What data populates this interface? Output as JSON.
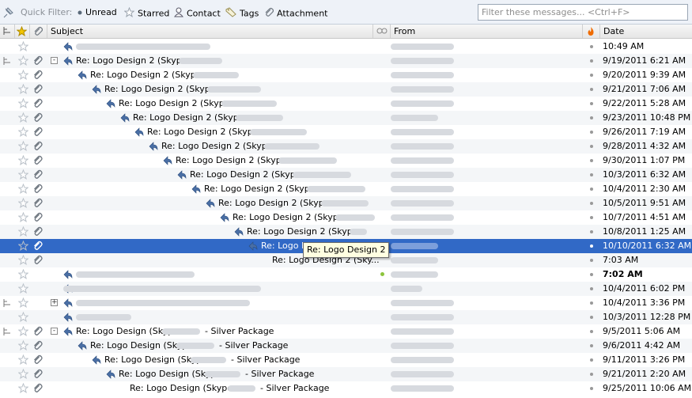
{
  "quick_filter": {
    "label": "Quick Filter:",
    "unread": "Unread",
    "starred": "Starred",
    "contact": "Contact",
    "tags": "Tags",
    "attachment": "Attachment",
    "search_placeholder": "Filter these messages... <Ctrl+F>"
  },
  "columns": {
    "subject": "Subject",
    "from": "From",
    "date": "Date"
  },
  "tooltip": "Re: Logo Design 2",
  "rows": [
    {
      "subject": "",
      "date": "10:49 AM"
    },
    {
      "subject": "Re: Logo Design 2 (Skype:",
      "date": "9/19/2011 6:21 AM"
    },
    {
      "subject": "Re: Logo Design 2 (Skype:",
      "date": "9/20/2011 9:39 AM"
    },
    {
      "subject": "Re: Logo Design 2 (Skype:",
      "date": "9/21/2011 7:06 AM"
    },
    {
      "subject": "Re: Logo Design 2 (Skype:",
      "date": "9/22/2011 5:28 AM"
    },
    {
      "subject": "Re: Logo Design 2 (Skype:",
      "date": "9/23/2011 10:48 PM"
    },
    {
      "subject": "Re: Logo Design 2 (Skype:",
      "date": "9/26/2011 7:19 AM"
    },
    {
      "subject": "Re: Logo Design 2 (Skype:",
      "date": "9/28/2011 4:32 AM"
    },
    {
      "subject": "Re: Logo Design 2 (Skype:",
      "date": "9/30/2011 1:07 PM"
    },
    {
      "subject": "Re: Logo Design 2 (Skype:",
      "date": "10/3/2011 6:32 AM"
    },
    {
      "subject": "Re: Logo Design 2 (Skype:",
      "date": "10/4/2011 2:30 AM"
    },
    {
      "subject": "Re: Logo Design 2 (Skype:",
      "date": "10/5/2011 9:51 AM"
    },
    {
      "subject": "Re: Logo Design 2 (Skype:",
      "date": "10/7/2011 4:51 AM"
    },
    {
      "subject": "Re: Logo Design 2 (Skype:",
      "date": "10/8/2011 1:25 AM"
    },
    {
      "subject": "Re: Logo D",
      "date": "10/10/2011 6:32 AM"
    },
    {
      "subject": "Re: Logo Design 2 (Sky...",
      "date": "7:03 AM"
    },
    {
      "subject": "",
      "date": "7:02 AM"
    },
    {
      "subject": "",
      "date": "10/4/2011 6:02 PM"
    },
    {
      "subject": "",
      "date": "10/4/2011 3:36 PM"
    },
    {
      "subject": "",
      "date": "10/3/2011 12:28 PM"
    },
    {
      "subject": "Re: Logo Design (Skype:",
      "suffix": "- Silver Package",
      "date": "9/5/2011 5:06 AM"
    },
    {
      "subject": "Re: Logo Design (Skype:",
      "suffix": "- Silver Package",
      "date": "9/6/2011 4:42 AM"
    },
    {
      "subject": "Re: Logo Design (Skype:",
      "suffix": "- Silver Package",
      "date": "9/11/2011 3:26 PM"
    },
    {
      "subject": "Re: Logo Design (Skype:",
      "suffix": "- Silver Package",
      "date": "9/21/2011 2:20 AM"
    },
    {
      "subject": "Re: Logo Design (Skype:",
      "suffix": "- Silver Package",
      "date": "9/25/2011 10:06 AM"
    }
  ]
}
